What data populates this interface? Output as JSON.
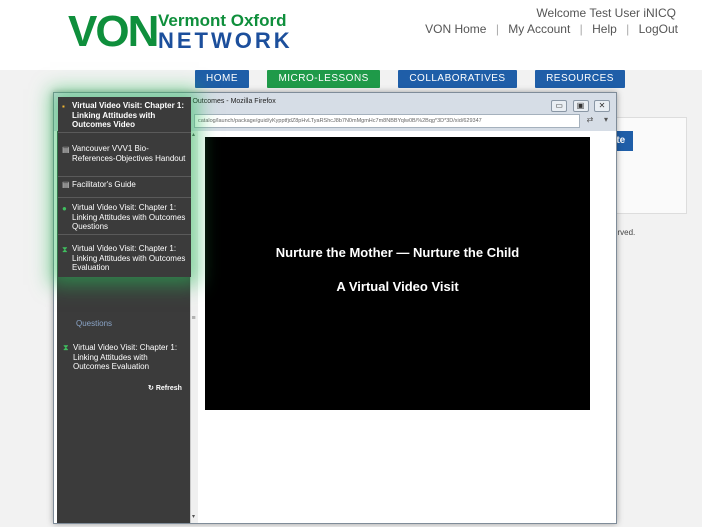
{
  "header": {
    "logo_von": "VON",
    "logo_line1": "Vermont Oxford",
    "logo_line2": "NETWORK",
    "welcome": "Welcome Test User iNICQ",
    "links": [
      "VON Home",
      "My Account",
      "Help",
      "LogOut"
    ]
  },
  "nav": {
    "items": [
      "HOME",
      "MICRO-LESSONS",
      "COLLABORATIVES",
      "RESOURCES"
    ],
    "active_index": 1
  },
  "background": {
    "create_label": "ate",
    "reserved": "erved."
  },
  "firefox": {
    "title": "tudes with Outcomes - Mozilla Firefox",
    "url": "catalog/launch/package/guid/yKypptfjdZ8pHvLTyaRShcJ8b7N0mMgmHc7m8NBBYqlw0B/%2Bqg*3D*3D/xid/629347",
    "win_buttons": [
      "▭",
      "▣",
      "✕"
    ],
    "url_buttons": [
      "⇄",
      "▾"
    ]
  },
  "sidebar": {
    "items": [
      {
        "text": "Virtual Video Visit: Chapter 1: Linking Attitudes with Outcomes Evaluation",
        "icon": "evaluation-icon"
      }
    ],
    "questions_stub": "Questions",
    "refresh": "Refresh"
  },
  "overlay": {
    "items": [
      {
        "text": "Virtual Video Visit: Chapter 1: Linking Attitudes with Outcomes Video",
        "icon": "video-icon"
      },
      {
        "text": "Vancouver VVV1 Bio-References-Objectives Handout",
        "icon": "document-icon"
      },
      {
        "text": "Facilitator's Guide",
        "icon": "document-icon"
      },
      {
        "text": "Virtual Video Visit: Chapter 1: Linking Attitudes with Outcomes Questions",
        "icon": "questions-icon"
      },
      {
        "text": "Virtual Video Visit: Chapter 1: Linking Attitudes with Outcomes Evaluation",
        "icon": "evaluation-icon"
      }
    ]
  },
  "video": {
    "title": "Nurture the Mother — Nurture the Child",
    "subtitle": "A Virtual Video Visit"
  },
  "colors": {
    "brand_green": "#0f8f3c",
    "brand_blue": "#1c4f9c",
    "nav_blue": "#1f5ea8",
    "nav_active": "#1f9a49",
    "sidebar_bg": "#3b3b3b",
    "glow": "#28be5a"
  }
}
